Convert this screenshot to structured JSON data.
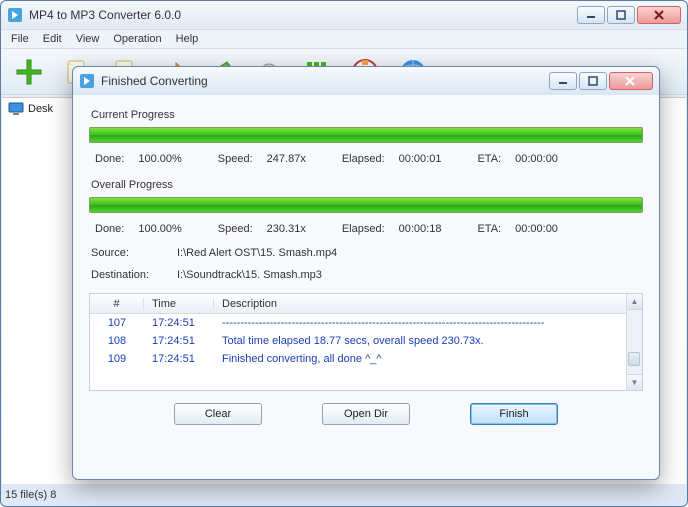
{
  "main": {
    "title": "MP4 to MP3 Converter 6.0.0",
    "menus": [
      "File",
      "Edit",
      "View",
      "Operation",
      "Help"
    ],
    "tree_item": "Desk",
    "status": "15 file(s)   8"
  },
  "dialog": {
    "title": "Finished Converting",
    "current": {
      "label": "Current Progress",
      "done_label": "Done:",
      "done": "100.00%",
      "speed_label": "Speed:",
      "speed": "247.87x",
      "elapsed_label": "Elapsed:",
      "elapsed": "00:00:01",
      "eta_label": "ETA:",
      "eta": "00:00:00",
      "percent": 100
    },
    "overall": {
      "label": "Overall Progress",
      "done_label": "Done:",
      "done": "100.00%",
      "speed_label": "Speed:",
      "speed": "230.31x",
      "elapsed_label": "Elapsed:",
      "elapsed": "00:00:18",
      "eta_label": "ETA:",
      "eta": "00:00:00",
      "percent": 100
    },
    "source_label": "Source:",
    "source": "I:\\Red Alert OST\\15. Smash.mp4",
    "dest_label": "Destination:",
    "dest": "I:\\Soundtrack\\15. Smash.mp3",
    "log": {
      "headers": {
        "num": "#",
        "time": "Time",
        "desc": "Description"
      },
      "rows": [
        {
          "n": "107",
          "t": "17:24:51",
          "d": "----------------------------------------------------------------------------------------"
        },
        {
          "n": "108",
          "t": "17:24:51",
          "d": "Total time elapsed 18.77 secs, overall speed 230.73x."
        },
        {
          "n": "109",
          "t": "17:24:51",
          "d": "Finished converting, all done ^_^"
        }
      ]
    },
    "buttons": {
      "clear": "Clear",
      "open_dir": "Open Dir",
      "finish": "Finish"
    }
  },
  "colors": {
    "accent_green": "#3bbf1f",
    "link_blue": "#1a3fb5"
  }
}
